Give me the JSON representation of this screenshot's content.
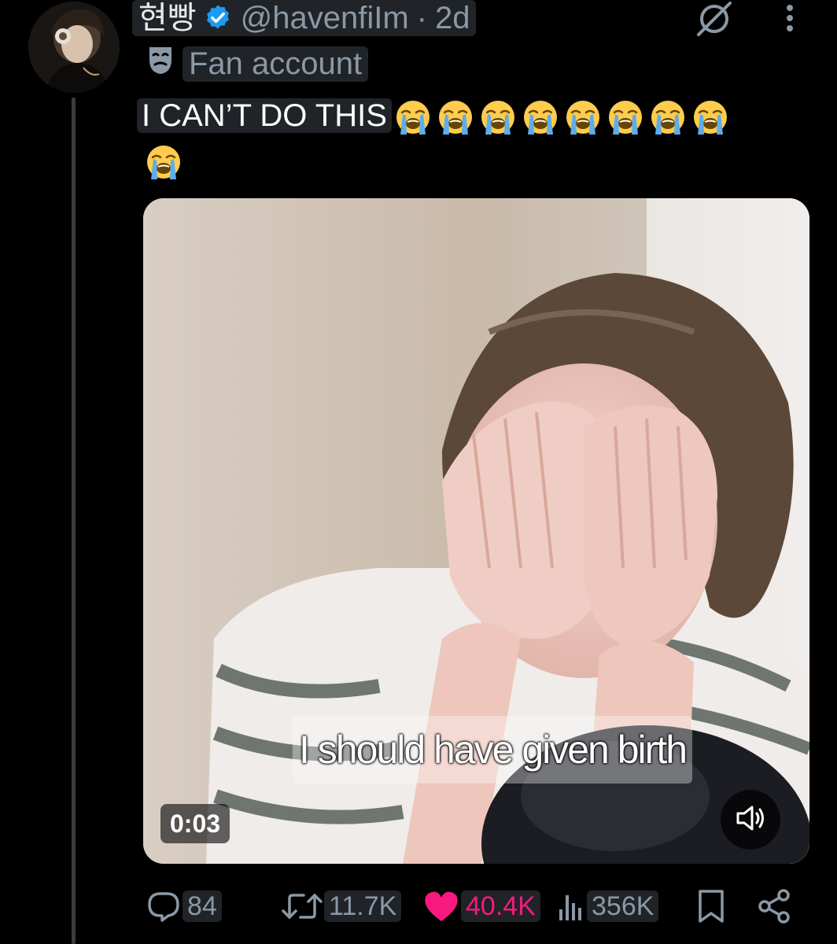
{
  "author": {
    "display_name": "현빵",
    "handle": "@havenfiIm",
    "separator": "·",
    "time_ago": "2d",
    "label": "Fan account",
    "verified": true,
    "verified_color": "#1d9bf0"
  },
  "tweet": {
    "text": "I CAN’T DO THIS",
    "emoji_name": "loudly-crying-face",
    "emoji_count": 9
  },
  "media": {
    "subtitle": "I should have given birth",
    "duration": "0:03",
    "sound_icon": "speaker-icon"
  },
  "actions": {
    "replies": "84",
    "reposts": "11.7K",
    "likes": "40.4K",
    "views": "356K",
    "like_color": "#f91880",
    "muted_color": "#8b98a5"
  },
  "icons": [
    "grok-icon",
    "more-icon",
    "fan-account-mask-icon",
    "reply-icon",
    "repost-icon",
    "like-icon",
    "views-icon",
    "bookmark-icon",
    "share-icon"
  ]
}
